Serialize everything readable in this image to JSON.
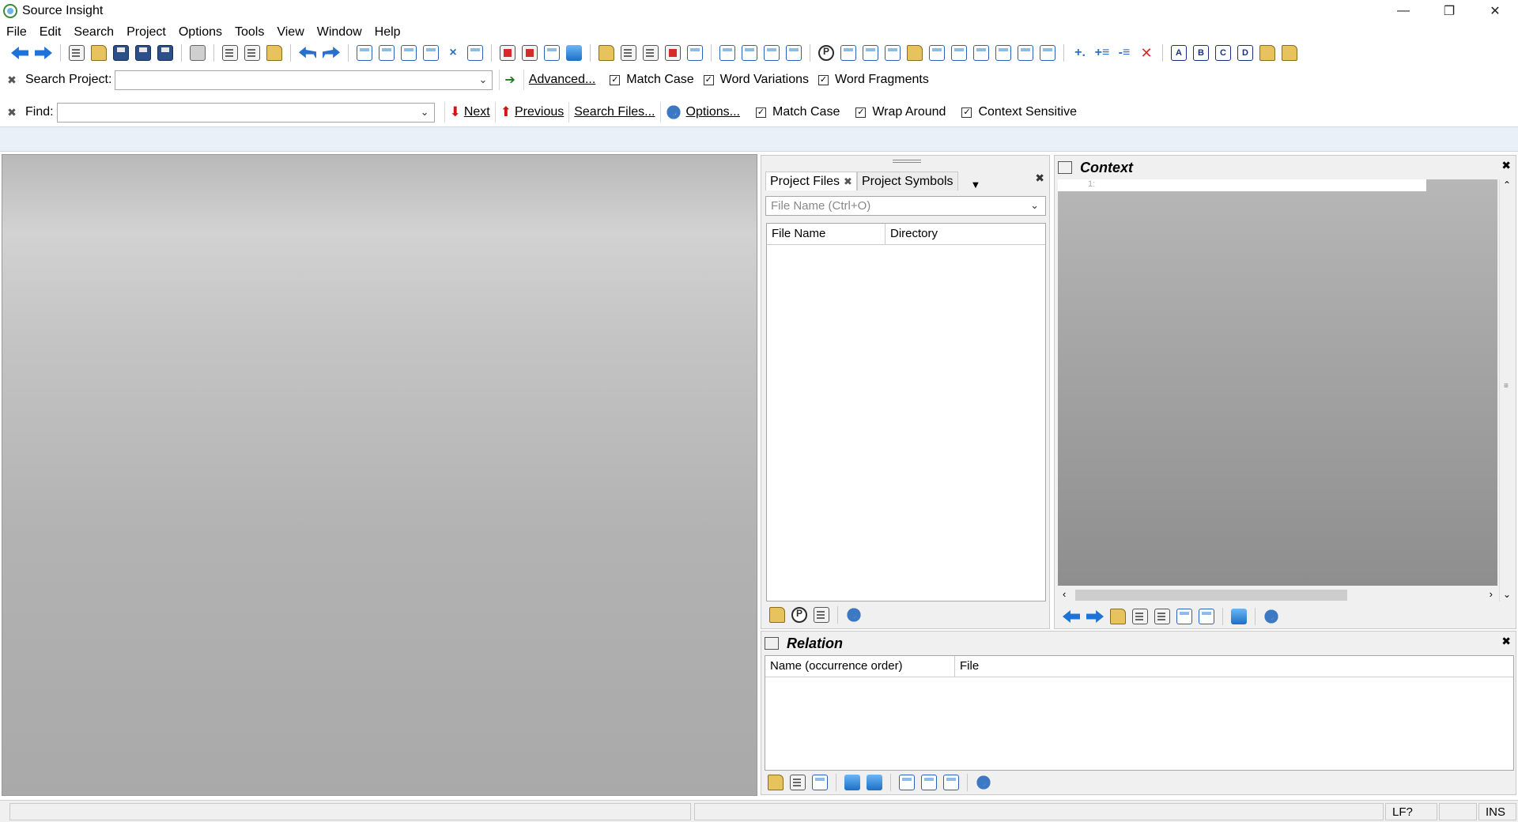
{
  "window": {
    "title": "Source Insight",
    "controls": {
      "minimize": "—",
      "restore": "❐",
      "close": "✕"
    }
  },
  "menu": [
    "File",
    "Edit",
    "Search",
    "Project",
    "Options",
    "Tools",
    "View",
    "Window",
    "Help"
  ],
  "search_project": {
    "close": "✖",
    "label": "Search Project:",
    "value": "",
    "advanced": "Advanced...",
    "options": [
      {
        "label": "Match Case",
        "checked": true
      },
      {
        "label": "Word Variations",
        "checked": true
      },
      {
        "label": "Word Fragments",
        "checked": true
      }
    ]
  },
  "find": {
    "close": "✖",
    "label": "Find:",
    "value": "",
    "next": "Next",
    "previous": "Previous",
    "search_files": "Search Files...",
    "options_btn": "Options...",
    "options": [
      {
        "label": "Match Case",
        "checked": true
      },
      {
        "label": "Wrap Around",
        "checked": true
      },
      {
        "label": "Context Sensitive",
        "checked": true
      }
    ]
  },
  "project_panel": {
    "tabs": [
      {
        "label": "Project Files",
        "active": true
      },
      {
        "label": "Project Symbols",
        "active": false
      }
    ],
    "filter_placeholder": "File Name (Ctrl+O)",
    "columns": [
      "File Name",
      "Directory"
    ]
  },
  "context_panel": {
    "title": "Context",
    "line_number": "1:"
  },
  "relation_panel": {
    "title": "Relation",
    "columns": [
      "Name (occurrence order)",
      "File"
    ]
  },
  "status": {
    "line_ending": "LF?",
    "mode": "INS"
  }
}
